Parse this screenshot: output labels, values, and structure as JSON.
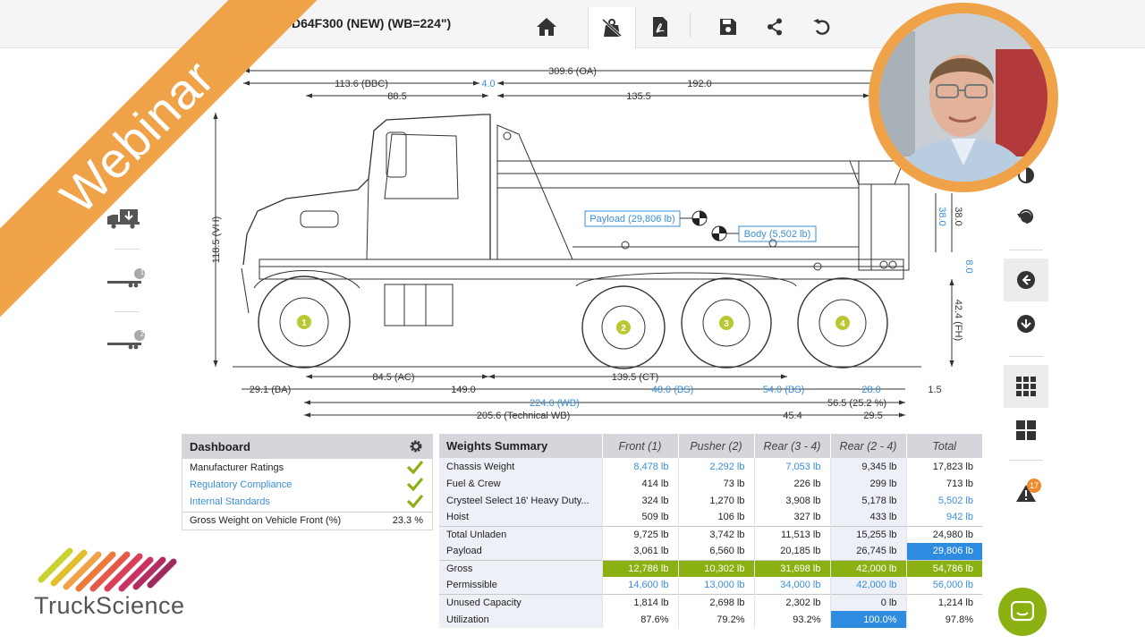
{
  "header": {
    "title": "D64F300 (NEW) (WB=224\")"
  },
  "toolbar": [
    {
      "name": "home-icon",
      "active": false
    },
    {
      "name": "weight-scale-icon",
      "active": true
    },
    {
      "name": "pdf-icon",
      "active": false
    },
    {
      "name": "save-icon",
      "active": false
    },
    {
      "name": "share-icon",
      "active": false
    },
    {
      "name": "undo-icon",
      "active": false
    }
  ],
  "dimensions": {
    "oa": "309.6 (OA)",
    "bbc": "113.6 (BBC)",
    "gap_top": "4.0",
    "top_192": "192.0",
    "cab": "88.5",
    "body_len": "135.5",
    "height": "118.5 (VH)",
    "right_38a": "38.0",
    "right_38b": "38.0",
    "right_8": "8.0",
    "fh": "42.4 (FH)",
    "ac": "84.5 (AC)",
    "ct": "139.5 (CT)",
    "ba": "29.1 (BA)",
    "d149": "149.0",
    "bs1": "48.0 (BS)",
    "bs2": "54.0 (BS)",
    "d28": "28.0",
    "d15": "1.5",
    "wb": "224.0 (WB)",
    "d565": "56.5 (25.2 %)",
    "twb": "205.6 (Technical WB)",
    "d454": "45.4",
    "d295": "29.5"
  },
  "callouts": {
    "payload": "Payload (29,806 lb)",
    "body": "Body (5,502 lb)"
  },
  "axles": [
    "1",
    "2",
    "3",
    "4"
  ],
  "left_rail": {
    "badge1": "1",
    "badge2": "2"
  },
  "right_rail": {
    "warning_count": "17"
  },
  "dashboard": {
    "title": "Dashboard",
    "rows": [
      {
        "label": "Manufacturer Ratings",
        "blue": false
      },
      {
        "label": "Regulatory Compliance",
        "blue": true
      },
      {
        "label": "Internal Standards",
        "blue": true
      }
    ],
    "last_label": "Gross Weight on Vehicle Front (%)",
    "last_value": "23.3 %"
  },
  "weights": {
    "title": "Weights Summary",
    "columns": [
      "Front (1)",
      "Pusher (2)",
      "Rear (3 - 4)",
      "Rear (2 - 4)",
      "Total"
    ],
    "rows": [
      {
        "label": "Chassis Weight",
        "values": [
          "8,478 lb",
          "2,292 lb",
          "7,053 lb",
          "9,345 lb",
          "17,823 lb"
        ],
        "blue": [
          true,
          true,
          true,
          false,
          false
        ],
        "sep": false
      },
      {
        "label": "Fuel & Crew",
        "values": [
          "414 lb",
          "73 lb",
          "226 lb",
          "299 lb",
          "713 lb"
        ],
        "blue": [
          false,
          false,
          false,
          false,
          false
        ],
        "sep": false
      },
      {
        "label": "Crysteel Select 16' Heavy Duty...",
        "values": [
          "324 lb",
          "1,270 lb",
          "3,908 lb",
          "5,178 lb",
          "5,502 lb"
        ],
        "blue": [
          false,
          false,
          false,
          false,
          true
        ],
        "sep": false
      },
      {
        "label": "Hoist",
        "values": [
          "509 lb",
          "106 lb",
          "327 lb",
          "433 lb",
          "942 lb"
        ],
        "blue": [
          false,
          false,
          false,
          false,
          true
        ],
        "sep": false
      },
      {
        "label": "Total Unladen",
        "values": [
          "9,725 lb",
          "3,742 lb",
          "11,513 lb",
          "15,255 lb",
          "24,980 lb"
        ],
        "blue": [
          false,
          false,
          false,
          false,
          false
        ],
        "sep": true
      },
      {
        "label": "Payload",
        "values": [
          "3,061 lb",
          "6,560 lb",
          "20,185 lb",
          "26,745 lb",
          "29,806 lb"
        ],
        "blue": [
          false,
          false,
          false,
          false,
          false
        ],
        "sep": false,
        "hl": 4
      },
      {
        "label": "Gross",
        "values": [
          "12,786 lb",
          "10,302 lb",
          "31,698 lb",
          "42,000 lb",
          "54,786 lb"
        ],
        "blue": [
          false,
          false,
          false,
          false,
          false
        ],
        "sep": true,
        "green": true
      },
      {
        "label": "Permissible",
        "values": [
          "14,600 lb",
          "13,000 lb",
          "34,000 lb",
          "42,000 lb",
          "56,000 lb"
        ],
        "blue": [
          true,
          true,
          true,
          true,
          true
        ],
        "sep": false
      },
      {
        "label": "Unused Capacity",
        "values": [
          "1,814 lb",
          "2,698 lb",
          "2,302 lb",
          "0 lb",
          "1,214 lb"
        ],
        "blue": [
          false,
          false,
          false,
          false,
          false
        ],
        "sep": true
      },
      {
        "label": "Utilization",
        "values": [
          "87.6%",
          "79.2%",
          "93.2%",
          "100.0%",
          "97.8%"
        ],
        "blue": [
          false,
          false,
          false,
          false,
          false
        ],
        "sep": false,
        "hl": 3
      }
    ]
  },
  "overlay": {
    "banner": "Webinar"
  },
  "logo": {
    "text": "TruckScience"
  },
  "colors": {
    "accent_orange": "#f0a248",
    "green": "#8bb012",
    "blue": "#3a8fd8",
    "highlight_blue": "#2d8be0",
    "header_gray": "#d4d6dc"
  }
}
